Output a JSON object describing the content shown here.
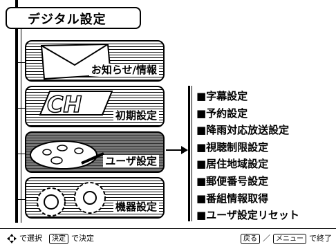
{
  "title": "デジタル設定",
  "tiles": [
    {
      "label": "お知らせ/情報",
      "icon": "envelope-icon"
    },
    {
      "label": "初期設定",
      "icon": "ch-icon"
    },
    {
      "label": "ユーザ設定",
      "icon": "palette-icon",
      "selected": true
    },
    {
      "label": "機器設定",
      "icon": "gears-icon"
    }
  ],
  "submenu": [
    "■字幕設定",
    "■予約設定",
    "■降雨対応放送設定",
    "■視聴制限設定",
    "■居住地域設定",
    "■郵便番号設定",
    "■番組情報取得",
    "■ユーザ設定リセット"
  ],
  "footer": {
    "select_text": "で選択",
    "enter_key": "決定",
    "enter_text": "で決定",
    "back_key": "戻る",
    "separator": "／",
    "menu_key": "メニュー",
    "exit_text": "で終了"
  }
}
